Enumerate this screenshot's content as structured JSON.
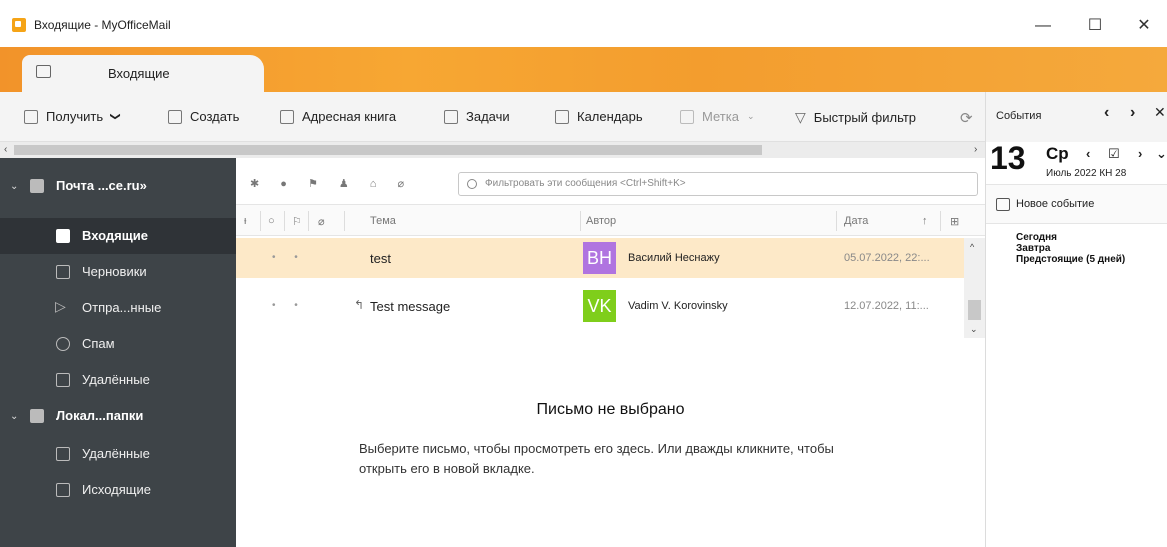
{
  "window": {
    "title": "Входящие - MyOfficeMail",
    "minimize": "—",
    "maximize": "☐",
    "close": "✕"
  },
  "tab": {
    "label": "Входящие"
  },
  "toolbar": {
    "receive": "Получить",
    "receive_caret": "❯",
    "create": "Создать",
    "address_book": "Адресная книга",
    "tasks": "Задачи",
    "calendar": "Календарь",
    "tag": "Метка",
    "quick_filter": "Быстрый фильтр"
  },
  "sidebar": {
    "accounts": [
      {
        "label": "Почта ...ce.ru»"
      },
      {
        "label": "Локал...папки"
      }
    ],
    "items": [
      {
        "label": "Входящие",
        "icon": "inbox-icon",
        "active": true
      },
      {
        "label": "Черновики",
        "icon": "drafts-icon"
      },
      {
        "label": "Отпра...нные",
        "icon": "sent-icon"
      },
      {
        "label": "Спам",
        "icon": "spam-icon"
      },
      {
        "label": "Удалённые",
        "icon": "trash-icon"
      },
      {
        "label": "Удалённые",
        "icon": "trash-icon"
      },
      {
        "label": "Исходящие",
        "icon": "outbox-icon"
      }
    ]
  },
  "messages": {
    "filter_placeholder": "Фильтровать эти сообщения <Ctrl+Shift+K>",
    "quick_icons": "✱ ● ⚑ ♟ ⌂ ⌀",
    "columns": {
      "subject": "Тема",
      "author": "Автор",
      "date": "Дата",
      "sort_arrow": "↑"
    },
    "rows": [
      {
        "subject": "test",
        "initials": "ВН",
        "avatar_color": "#b074e0",
        "author": "Василий Неснажу",
        "date": "05.07.2022, 22:...",
        "selected": true
      },
      {
        "subject": "Test message",
        "initials": "VK",
        "avatar_color": "#7fce1b",
        "author": "Vadim V. Korovinsky",
        "date": "12.07.2022, 11:...",
        "selected": false
      }
    ],
    "empty_title": "Письмо не выбрано",
    "empty_text": "Выберите письмо, чтобы просмотреть его здесь. Или дважды кликните, чтобы открыть его в новой вкладке."
  },
  "events": {
    "title": "События",
    "day": "13",
    "weekday": "Ср",
    "month_year": "Июль 2022",
    "week": "КН 28",
    "new_event": "Новое событие",
    "groups": [
      "Сегодня",
      "Завтра",
      "Предстоящие (5 дней)"
    ]
  },
  "colors": {
    "accent_orange": "#f39d2e",
    "sidebar_bg": "#3e4448",
    "selected_row": "#fde9c8"
  }
}
